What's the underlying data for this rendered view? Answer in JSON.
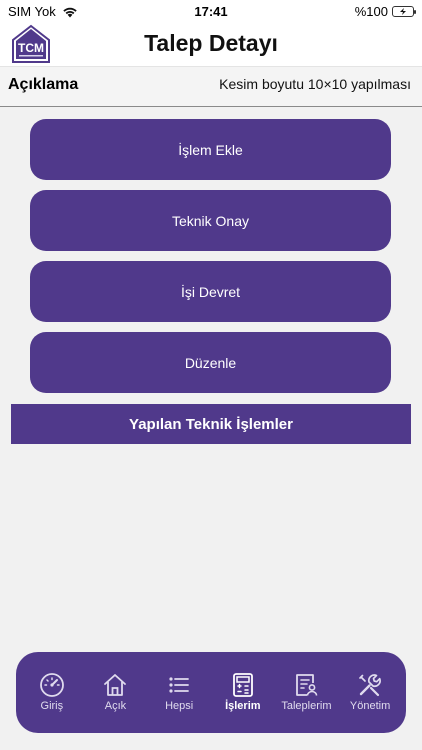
{
  "status_bar": {
    "carrier": "SIM Yok",
    "time": "17:41",
    "battery": "%100"
  },
  "header": {
    "logo_text": "TCM",
    "title": "Talep Detayı"
  },
  "description": {
    "label": "Açıklama",
    "value": "Kesim boyutu 10×10 yapılması"
  },
  "actions": [
    {
      "label": "İşlem Ekle"
    },
    {
      "label": "Teknik Onay"
    },
    {
      "label": "İşi Devret"
    },
    {
      "label": "Düzenle"
    }
  ],
  "section": {
    "title": "Yapılan Teknik İşlemler"
  },
  "tabs": [
    {
      "label": "Giriş",
      "icon": "gauge-icon"
    },
    {
      "label": "Açık",
      "icon": "home-icon"
    },
    {
      "label": "Hepsi",
      "icon": "list-icon"
    },
    {
      "label": "İşlerim",
      "icon": "calculator-icon",
      "active": true
    },
    {
      "label": "Taleplerim",
      "icon": "user-document-icon"
    },
    {
      "label": "Yönetim",
      "icon": "wrench-icon"
    }
  ],
  "colors": {
    "primary": "#50398b",
    "battery": "#4cd964",
    "background": "#f1f1f1"
  }
}
